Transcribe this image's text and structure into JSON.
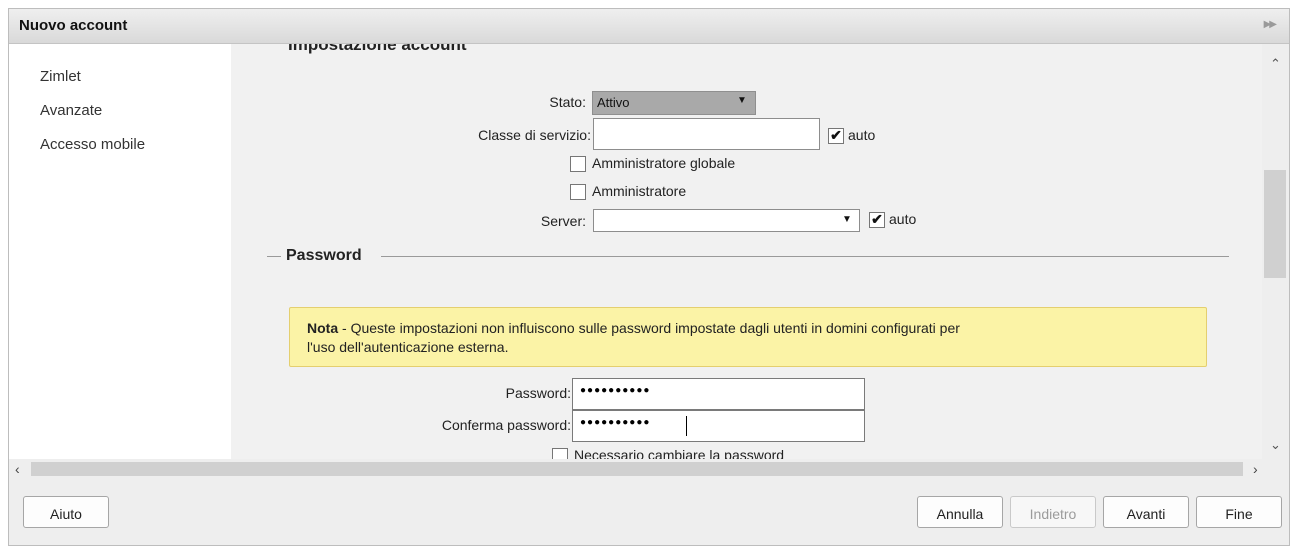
{
  "dialog": {
    "title": "Nuovo account"
  },
  "sidebar": {
    "items": [
      {
        "label": "Zimlet"
      },
      {
        "label": "Avanzate"
      },
      {
        "label": "Accesso mobile"
      }
    ]
  },
  "account": {
    "section_title": "Impostazione account",
    "stato": {
      "label": "Stato:",
      "value": "Attivo"
    },
    "classe": {
      "label": "Classe di servizio:",
      "value": "",
      "auto_label": "auto",
      "auto_checked": true
    },
    "admin_global": {
      "label": "Amministratore globale",
      "checked": false
    },
    "admin": {
      "label": "Amministratore",
      "checked": false
    },
    "server": {
      "label": "Server:",
      "value": "",
      "auto_label": "auto",
      "auto_checked": true
    }
  },
  "password": {
    "section_title": "Password",
    "note_bold": "Nota",
    "note_text": " - Queste impostazioni non influiscono sulle password impostate dagli utenti in domini configurati per",
    "note_text2": "l'uso dell'autenticazione esterna.",
    "password_label": "Password:",
    "password_mask": "●●●●●●●●●●",
    "confirm_label": "Conferma password:",
    "confirm_mask": "●●●●●●●●●●",
    "must_change_label": "Necessario cambiare la password",
    "must_change_checked": false
  },
  "footer": {
    "help": "Aiuto",
    "cancel": "Annulla",
    "back": "Indietro",
    "next": "Avanti",
    "finish": "Fine"
  },
  "colors": {
    "note_bg": "#fbf3a6",
    "note_border": "#e4cf6f",
    "select_bg": "#a9a9a9"
  }
}
